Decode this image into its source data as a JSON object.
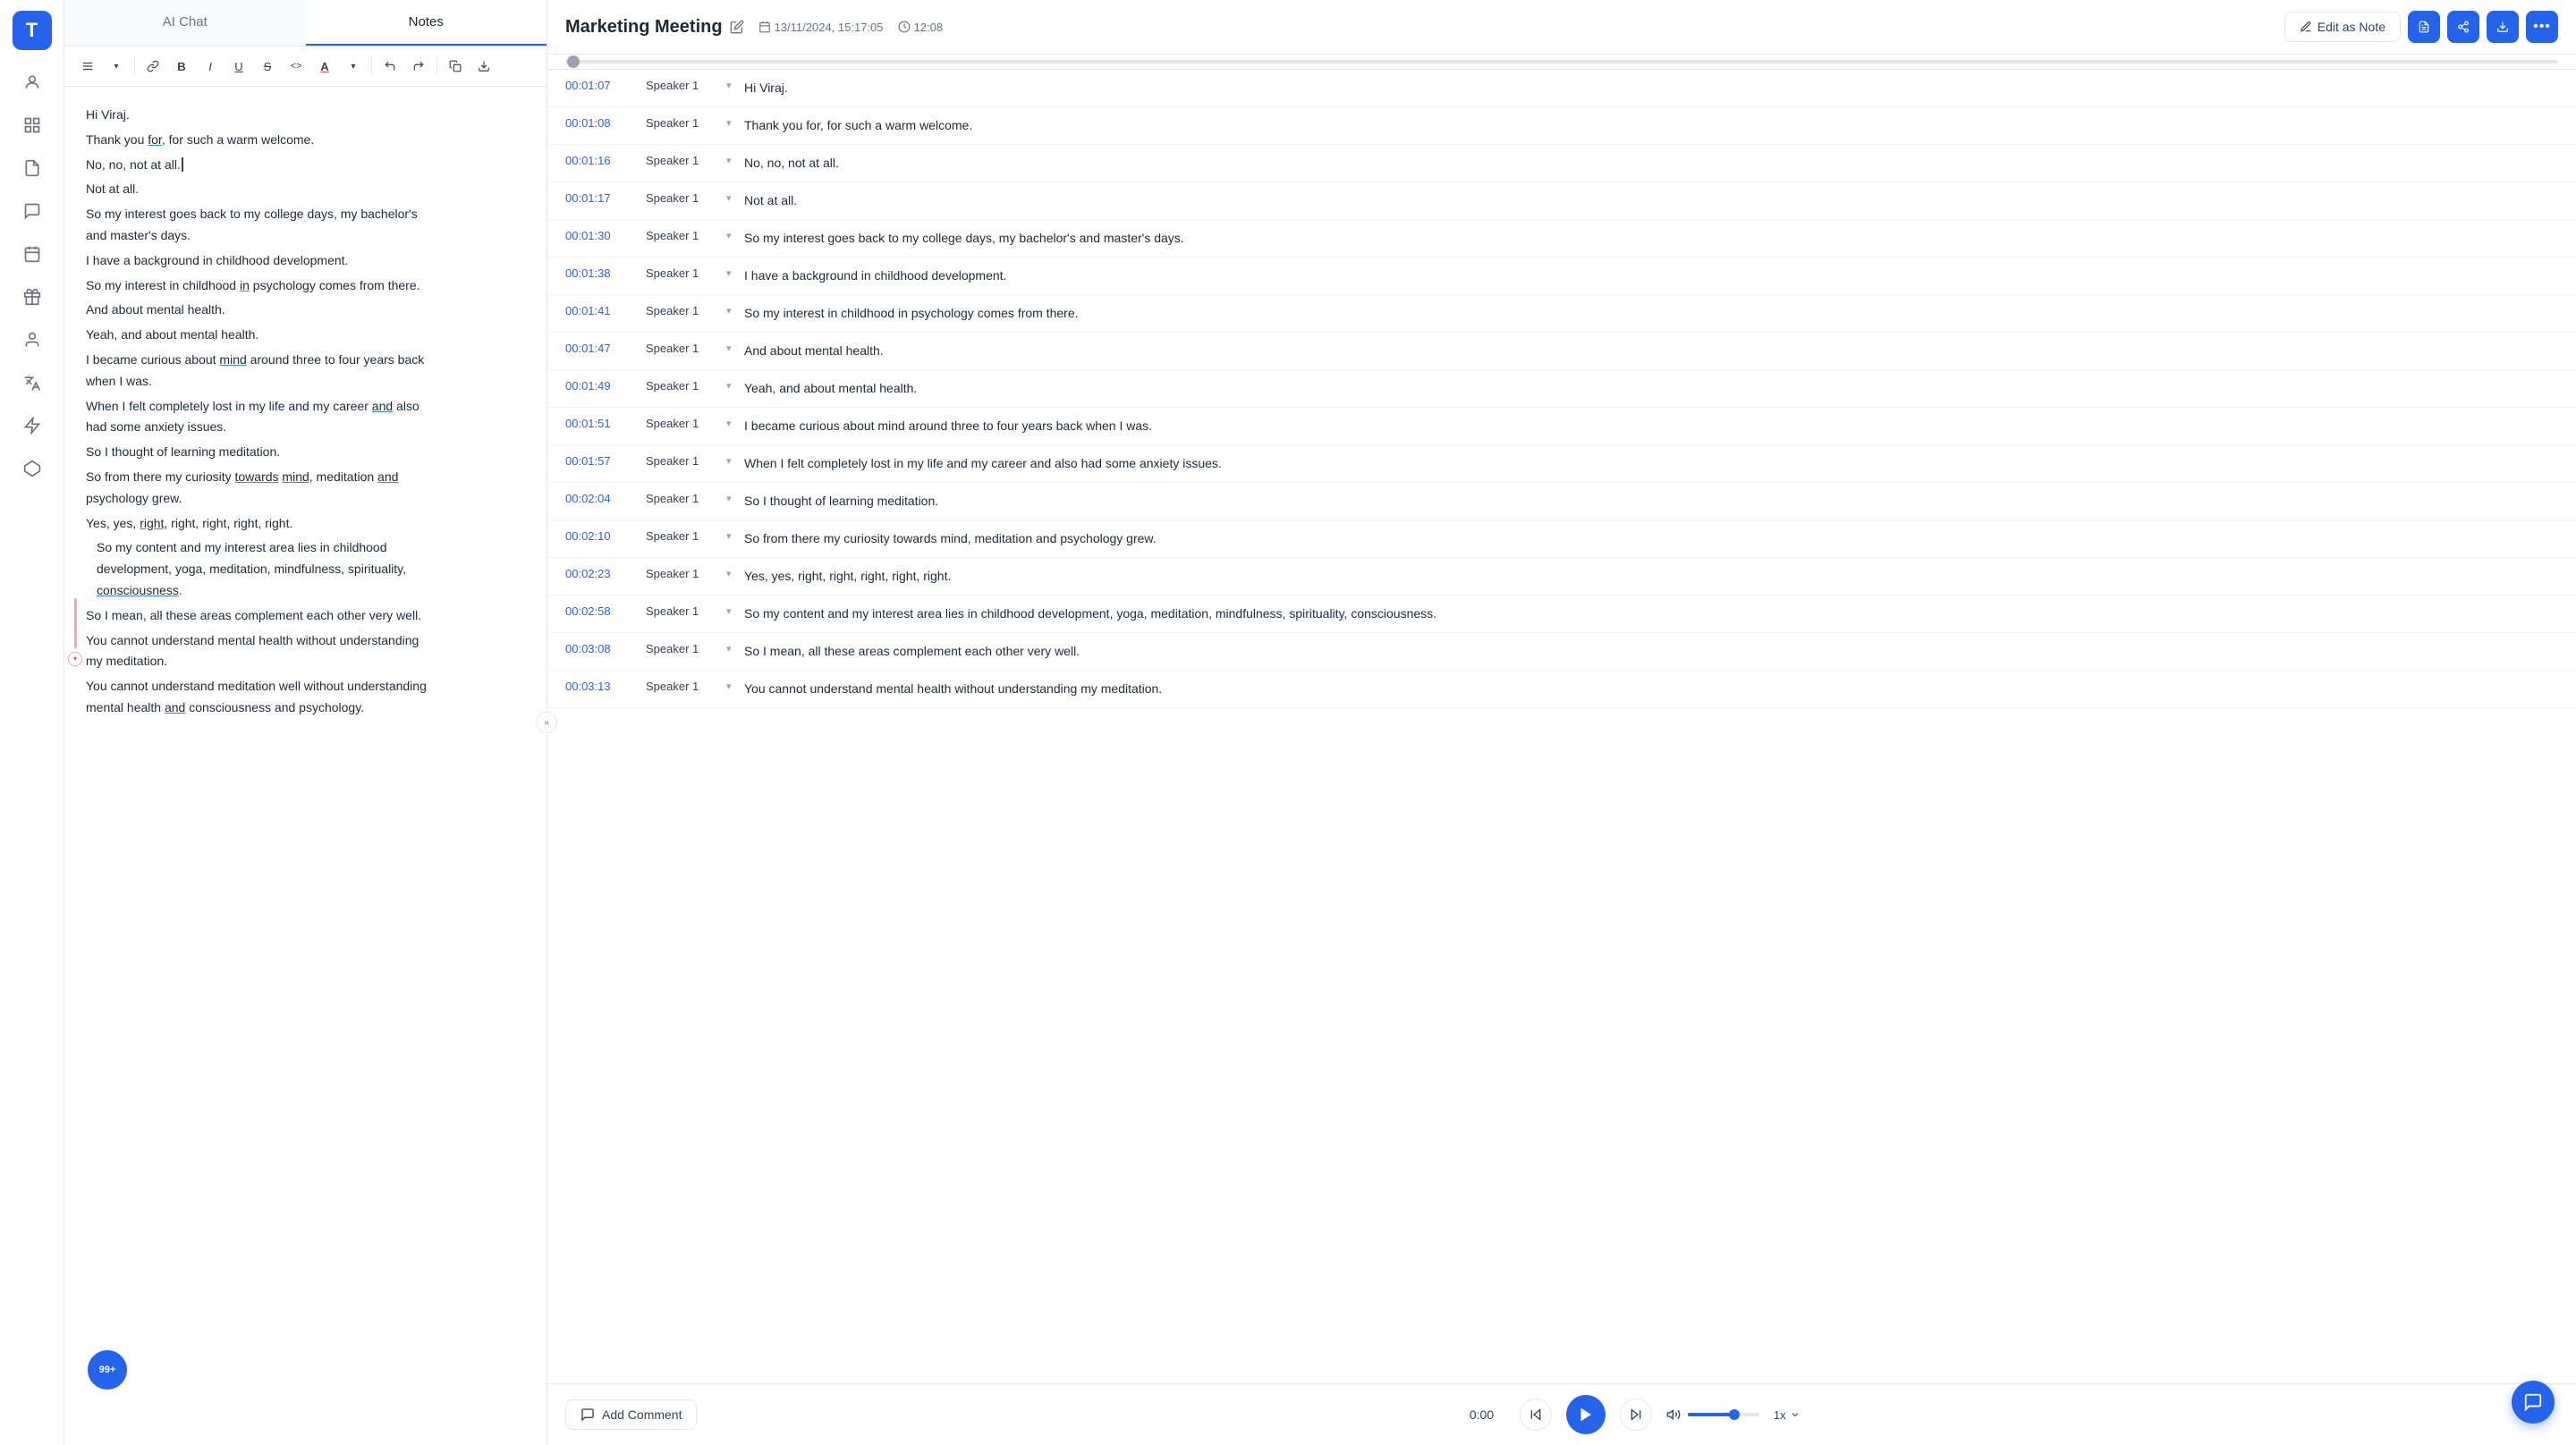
{
  "sidebar": {
    "logo": "T",
    "items": [
      {
        "name": "people-icon",
        "icon": "👤",
        "active": false
      },
      {
        "name": "grid-icon",
        "icon": "⊞",
        "active": false
      },
      {
        "name": "document-icon",
        "icon": "📄",
        "active": false
      },
      {
        "name": "chat-icon",
        "icon": "💬",
        "active": false
      },
      {
        "name": "calendar-icon",
        "icon": "📅",
        "active": false
      },
      {
        "name": "gift-icon",
        "icon": "🎁",
        "active": false
      },
      {
        "name": "user-icon",
        "icon": "👤",
        "active": false
      },
      {
        "name": "translate-icon",
        "icon": "A↑",
        "active": false
      },
      {
        "name": "bolt-icon",
        "icon": "⚡",
        "active": false
      },
      {
        "name": "diamond-icon",
        "icon": "◇",
        "active": false
      }
    ]
  },
  "tabs": [
    {
      "label": "AI Chat",
      "active": false
    },
    {
      "label": "Notes",
      "active": true
    }
  ],
  "toolbar": {
    "buttons": [
      {
        "name": "align-icon",
        "icon": "≡"
      },
      {
        "name": "chevron-down-icon",
        "icon": "▾"
      },
      {
        "name": "link-icon",
        "icon": "🔗"
      },
      {
        "name": "bold-icon",
        "icon": "B"
      },
      {
        "name": "italic-icon",
        "icon": "I"
      },
      {
        "name": "underline-icon",
        "icon": "U"
      },
      {
        "name": "strikethrough-icon",
        "icon": "S"
      },
      {
        "name": "code-icon",
        "icon": "<>"
      },
      {
        "name": "text-color-icon",
        "icon": "A"
      },
      {
        "name": "color-chevron-icon",
        "icon": "▾"
      },
      {
        "name": "undo-icon",
        "icon": "↶"
      },
      {
        "name": "redo-icon",
        "icon": "↷"
      },
      {
        "name": "copy-icon",
        "icon": "⧉"
      },
      {
        "name": "download-icon",
        "icon": "⬇"
      }
    ]
  },
  "editor": {
    "lines": [
      "Hi Viraj.",
      "Thank you for, for such a warm welcome.",
      "No, no, not at all.",
      "Not at all.",
      "So my interest goes back to my college days, my bachelor's and master's days.",
      "I have a background in childhood development.",
      "So my interest in childhood in psychology comes from there.",
      "And about mental health.",
      "Yeah, and about mental health.",
      "I became curious about mind around three to four years back when I was.",
      "When I felt completely lost in my life and my career and also had some anxiety issues.",
      "So I thought of learning meditation.",
      "So from there my curiosity towards mind, meditation and psychology grew.",
      "Yes, yes, right, right, right, right, right.",
      "So my content and my interest area lies in childhood development, yoga, meditation, mindfulness, spirituality, consciousness.",
      "So I mean, all these areas complement each other very well.",
      "You cannot understand mental health without understanding my meditation.",
      "You cannot understand meditation well without understanding mental health and consciousness and psychology."
    ]
  },
  "notification": {
    "badge": "99+"
  },
  "meeting": {
    "title": "Marketing Meeting",
    "date": "13/11/2024, 15:17:05",
    "duration": "12:08",
    "edit_as_note": "Edit as Note"
  },
  "transcript": [
    {
      "time": "00:01:07",
      "speaker": "Speaker 1",
      "text": "Hi Viraj."
    },
    {
      "time": "00:01:08",
      "speaker": "Speaker 1",
      "text": "Thank you for, for such a warm welcome."
    },
    {
      "time": "00:01:16",
      "speaker": "Speaker 1",
      "text": "No, no, not at all."
    },
    {
      "time": "00:01:17",
      "speaker": "Speaker 1",
      "text": "Not at all."
    },
    {
      "time": "00:01:30",
      "speaker": "Speaker 1",
      "text": "So my interest goes back to my college days, my bachelor's and master's days."
    },
    {
      "time": "00:01:38",
      "speaker": "Speaker 1",
      "text": "I have a background in childhood development."
    },
    {
      "time": "00:01:41",
      "speaker": "Speaker 1",
      "text": "So my interest in childhood in psychology comes from there."
    },
    {
      "time": "00:01:47",
      "speaker": "Speaker 1",
      "text": "And about mental health."
    },
    {
      "time": "00:01:49",
      "speaker": "Speaker 1",
      "text": "Yeah, and about mental health."
    },
    {
      "time": "00:01:51",
      "speaker": "Speaker 1",
      "text": "I became curious about mind around three to four years back when I was."
    },
    {
      "time": "00:01:57",
      "speaker": "Speaker 1",
      "text": "When I felt completely lost in my life and my career and also had some anxiety issues."
    },
    {
      "time": "00:02:04",
      "speaker": "Speaker 1",
      "text": "So I thought of learning meditation."
    },
    {
      "time": "00:02:10",
      "speaker": "Speaker 1",
      "text": "So from there my curiosity towards mind, meditation and psychology grew."
    },
    {
      "time": "00:02:23",
      "speaker": "Speaker 1",
      "text": "Yes, yes, right, right, right, right, right."
    },
    {
      "time": "00:02:58",
      "speaker": "Speaker 1",
      "text": "So my content and my interest area lies in childhood development, yoga, meditation, mindfulness, spirituality, consciousness."
    },
    {
      "time": "00:03:08",
      "speaker": "Speaker 1",
      "text": "So I mean, all these areas complement each other very well."
    },
    {
      "time": "00:03:13",
      "speaker": "Speaker 1",
      "text": "You cannot understand mental health without understanding my meditation."
    }
  ],
  "player": {
    "time_current": "0:00",
    "speed": "1x",
    "add_comment": "Add Comment"
  },
  "actions": {
    "pdf_icon": "📄",
    "share_icon": "⬆",
    "download_icon": "⬇",
    "more_icon": "•••"
  }
}
